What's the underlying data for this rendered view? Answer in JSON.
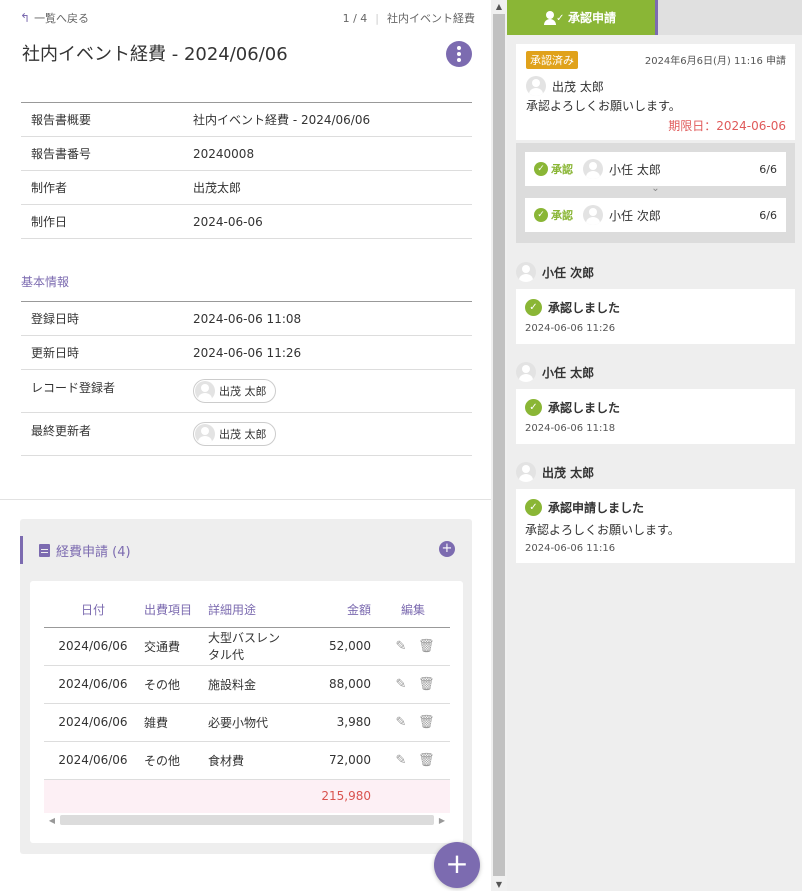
{
  "nav": {
    "back_label": "一覧へ戻る",
    "pager": "1 / 4",
    "report_name_short": "社内イベント経費"
  },
  "title": "社内イベント経費 - 2024/06/06",
  "summary": {
    "rows": [
      {
        "label": "報告書概要",
        "value": "社内イベント経費 - 2024/06/06"
      },
      {
        "label": "報告書番号",
        "value": "20240008"
      },
      {
        "label": "制作者",
        "value": "出茂太郎"
      },
      {
        "label": "制作日",
        "value": "2024-06-06"
      }
    ]
  },
  "basic": {
    "section_label": "基本情報",
    "registered_label": "登録日時",
    "registered_value": "2024-06-06 11:08",
    "updated_label": "更新日時",
    "updated_value": "2024-06-06 11:26",
    "recorder_label": "レコード登録者",
    "recorder_value": "出茂 太郎",
    "last_editor_label": "最終更新者",
    "last_editor_value": "出茂 太郎"
  },
  "expense": {
    "title": "経費申請 (4)",
    "headers": {
      "date": "日付",
      "item": "出費項目",
      "detail": "詳細用途",
      "amount": "金額",
      "edit": "編集"
    },
    "rows": [
      {
        "date": "2024/06/06",
        "item": "交通費",
        "detail": "大型バスレンタル代",
        "amount": "52,000"
      },
      {
        "date": "2024/06/06",
        "item": "その他",
        "detail": "施設料金",
        "amount": "88,000"
      },
      {
        "date": "2024/06/06",
        "item": "雑費",
        "detail": "必要小物代",
        "amount": "3,980"
      },
      {
        "date": "2024/06/06",
        "item": "その他",
        "detail": "食材費",
        "amount": "72,000"
      }
    ],
    "total": "215,980"
  },
  "approval": {
    "tab_label": "承認申請",
    "badge": "承認済み",
    "request_time": "2024年6月6日(月) 11:16 申請",
    "requester": "出茂 太郎",
    "message": "承認よろしくお願いします。",
    "deadline": "期限日：2024-06-06",
    "approvers": [
      {
        "status": "承認",
        "name": "小任 太郎",
        "frac": "6/6"
      },
      {
        "status": "承認",
        "name": "小任 次郎",
        "frac": "6/6"
      }
    ],
    "timeline": [
      {
        "user": "小任 次郎",
        "action": "承認しました",
        "message": "",
        "time": "2024-06-06 11:26"
      },
      {
        "user": "小任 太郎",
        "action": "承認しました",
        "message": "",
        "time": "2024-06-06 11:18"
      },
      {
        "user": "出茂 太郎",
        "action": "承認申請しました",
        "message": "承認よろしくお願いします。",
        "time": "2024-06-06 11:16"
      }
    ]
  },
  "colors": {
    "accent": "#7c6bb0",
    "approve_green": "#8ab636",
    "badge_orange": "#e0a21b",
    "deadline_red": "#e05a5a"
  }
}
